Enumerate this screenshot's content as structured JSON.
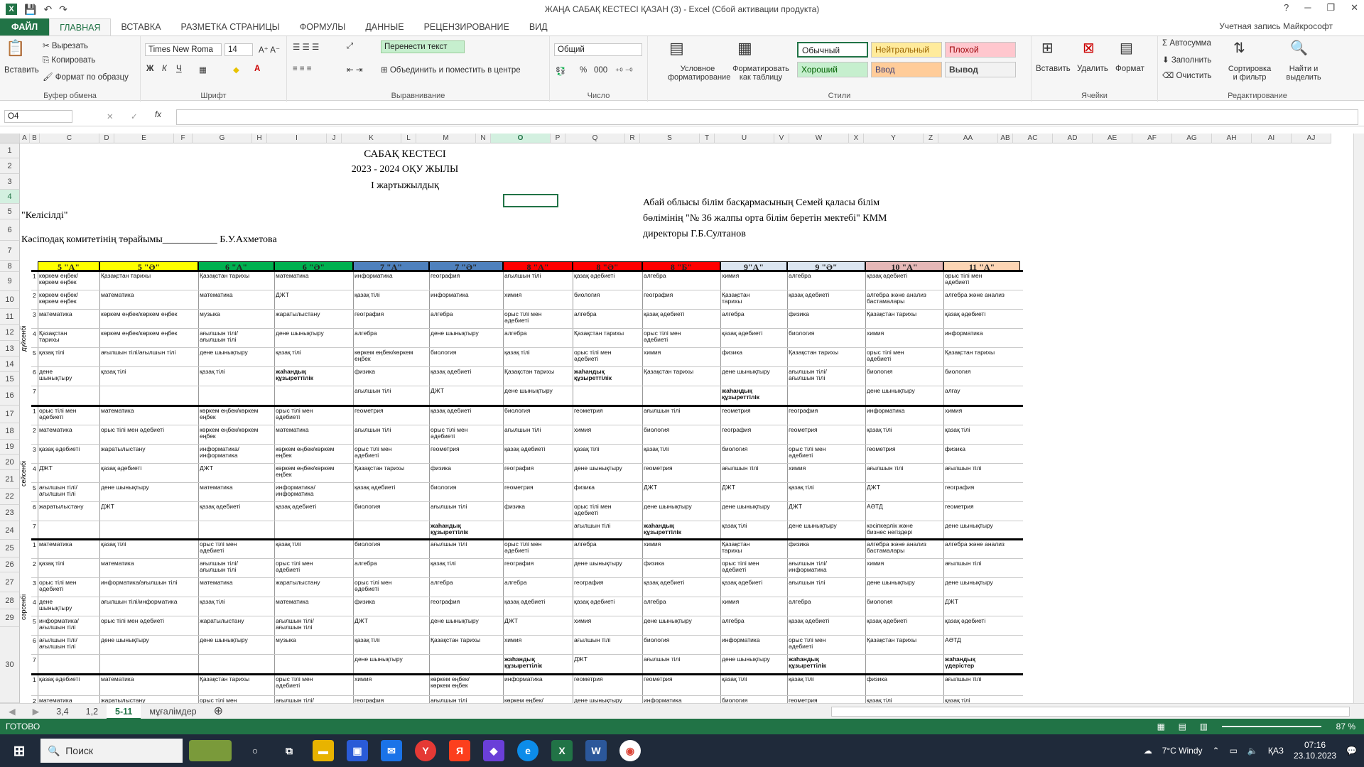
{
  "window": {
    "title": "ЖАҢА САБАҚ КЕСТЕСІ ҚАЗАН (3) - Excel (Сбой активации продукта)",
    "help": "?",
    "min": "─",
    "restore": "❐",
    "close": "✕"
  },
  "tabs": [
    "ФАЙЛ",
    "ГЛАВНАЯ",
    "ВСТАВКА",
    "РАЗМЕТКА СТРАНИЦЫ",
    "ФОРМУЛЫ",
    "ДАННЫЕ",
    "РЕЦЕНЗИРОВАНИЕ",
    "ВИД"
  ],
  "account": "Учетная запись Майкрософт",
  "ribbon": {
    "clipboard": {
      "label": "Буфер обмена",
      "paste": "Вставить",
      "cut": "Вырезать",
      "copy": "Копировать",
      "painter": "Формат по образцу"
    },
    "font": {
      "label": "Шрифт",
      "name": "Times New Roma",
      "size": "14"
    },
    "align": {
      "label": "Выравнивание",
      "wrap": "Перенести текст",
      "merge": "Объединить и поместить в центре"
    },
    "number": {
      "label": "Число",
      "format": "Общий",
      "percent": "%",
      "thousands": "000"
    },
    "styles": {
      "label": "Стили",
      "cond": "Условное форматирование",
      "table": "Форматировать как таблицу",
      "normal": "Обычный",
      "neutral": "Нейтральный",
      "bad": "Плохой",
      "good": "Хороший",
      "input": "Ввод",
      "output": "Вывод"
    },
    "cells": {
      "label": "Ячейки",
      "insert": "Вставить",
      "delete": "Удалить",
      "format": "Формат"
    },
    "edit": {
      "label": "Редактирование",
      "autosum": "Автосумма",
      "fill": "Заполнить",
      "clear": "Очистить",
      "sort": "Сортировка и фильтр",
      "find": "Найти и выделить"
    }
  },
  "namebox": "O4",
  "fx": "fx",
  "columns": [
    "A",
    "B",
    "C",
    "D",
    "E",
    "F",
    "G",
    "H",
    "I",
    "J",
    "K",
    "L",
    "M",
    "N",
    "O",
    "P",
    "Q",
    "R",
    "S",
    "T",
    "U",
    "V",
    "W",
    "X",
    "Y",
    "Z",
    "AA",
    "AB",
    "AC",
    "AD",
    "AE",
    "AF",
    "AG",
    "AH",
    "AI",
    "AJ"
  ],
  "rows": [
    "1",
    "2",
    "3",
    "4",
    "5",
    "6",
    "7",
    "8",
    "9",
    "10",
    "11",
    "12",
    "13",
    "14",
    "15",
    "16",
    "17",
    "18",
    "19",
    "20",
    "21",
    "22",
    "23",
    "24",
    "25",
    "26",
    "27",
    "28",
    "29",
    "30"
  ],
  "header": {
    "t1": "САБАҚ КЕСТЕСІ",
    "t2": "2023 - 2024 ОҚУ ЖЫЛЫ",
    "t3": "І жартыжылдық",
    "agreed": "\"Келісілді\"",
    "union": "Кәсіподақ комитетінің төрайымы___________ Б.У.Ахметова",
    "r1": "Абай облысы білім басқармасының Семей қаласы білім",
    "r2": "бөлімінің  \"№ 36 жалпы орта білім беретін мектебі\" КММ",
    "r3": "директоры                      Г.Б.Султанов"
  },
  "classes": [
    {
      "name": "5 \"А\"",
      "color": "#ffff00"
    },
    {
      "name": "5 \"Ә\"",
      "color": "#ffff00"
    },
    {
      "name": "6 \"А\"",
      "color": "#00b050"
    },
    {
      "name": "6 \"Ә\"",
      "color": "#00b050"
    },
    {
      "name": "7 \"А\"",
      "color": "#4f81bd"
    },
    {
      "name": "7 \"Ә\"",
      "color": "#4f81bd"
    },
    {
      "name": "8 \"А\"",
      "color": "#ff0000"
    },
    {
      "name": "8 \"Ә\"",
      "color": "#ff0000"
    },
    {
      "name": "8 \"Б\"",
      "color": "#ff0000"
    },
    {
      "name": "9\"А\"",
      "color": "#dce6f1"
    },
    {
      "name": "9 \"Ә\"",
      "color": "#dce6f1"
    },
    {
      "name": "10 \"А\"",
      "color": "#e6b8b7"
    },
    {
      "name": "11 \"А\"",
      "color": "#fcd5b4"
    }
  ],
  "days": [
    "дүйсенбі",
    "сейсенбі",
    "сәрсенбі"
  ],
  "monday": [
    [
      "көркем еңбек/көркем еңбек",
      "Қазақстан тарихы",
      "Қазақстан тарихы",
      "математика",
      "информатика",
      "география",
      "ағылшын тілі",
      "қазақ әдебиеті",
      "алгебра",
      "химия",
      "алгебра",
      "қазақ әдебиеті",
      "орыс тілі мен әдебиеті"
    ],
    [
      "көркем еңбек/көркем еңбек",
      "математика",
      "математика",
      "ДЖТ",
      "қазақ тілі",
      "информатика",
      "химия",
      "биология",
      "география",
      "Қазақстан тарихы",
      "қазақ әдебиеті",
      "алгебра және анализ бастамалары",
      "алгебра және анализ"
    ],
    [
      "математика",
      "көркем еңбек/көркем еңбек",
      "музыка",
      "жаратылыстану",
      "география",
      "алгебра",
      "орыс тілі мен әдебиеті",
      "алгебра",
      "қазақ әдебиеті",
      "алгебра",
      "физика",
      "Қазақстан тарихы",
      "қазақ әдебиеті"
    ],
    [
      "Қазақстан тарихы",
      "көркем еңбек/көркем еңбек",
      "ағылшын тілі/ағылшын тілі",
      "дене шынықтыру",
      "алгебра",
      "дене шынықтыру",
      "алгебра",
      "Қазақстан тарихы",
      "орыс тілі мен әдебиеті",
      "қазақ әдебиеті",
      "биология",
      "химия",
      "информатика"
    ],
    [
      "қазақ тілі",
      "ағылшын тілі/ағылшын тілі",
      "дене шынықтыру",
      "қазақ тілі",
      "көркем еңбек/көркем еңбек",
      "биология",
      "қазақ тілі",
      "орыс тілі мен әдебиеті",
      "химия",
      "физика",
      "Қазақстан тарихы",
      "орыс тілі мен әдебиеті",
      "Қазақстан тарихы"
    ],
    [
      "дене шынықтыру",
      "қазақ тілі",
      "қазақ тілі",
      "жаһандық құзыреттілік",
      "физика",
      "қазақ әдебиеті",
      "Қазақстан тарихы",
      "жаһандық құзыреттілік",
      "Қазақстан тарихы",
      "дене шынықтыру",
      "ағылшын тілі/ағылшын тілі",
      "биология",
      "биология"
    ],
    [
      "",
      "",
      "",
      "",
      "ағылшын тілі",
      "ДЖТ",
      "дене шынықтыру",
      "",
      "",
      "жаһандық құзыреттілік",
      "",
      "дене шынықтыру",
      "алгау"
    ]
  ],
  "tuesday": [
    [
      "орыс тілі мен әдебиеті",
      "математика",
      "көркем еңбек/көркем еңбек",
      "орыс тілі мен әдебиеті",
      "геометрия",
      "қазақ әдебиеті",
      "биология",
      "геометрия",
      "ағылшын тілі",
      "геометрия",
      "география",
      "информатика",
      "химия"
    ],
    [
      "математика",
      "орыс тілі мен әдебиеті",
      "көркем еңбек/көркем еңбек",
      "математика",
      "ағылшын тілі",
      "орыс тілі мен әдебиеті",
      "ағылшын тілі",
      "химия",
      "биология",
      "география",
      "геометрия",
      "қазақ тілі",
      "қазақ тілі"
    ],
    [
      "қазақ әдебиеті",
      "жаратылыстану",
      "информатика/информатика",
      "көркем еңбек/көркем еңбек",
      "орыс тілі мен әдебиеті",
      "геометрия",
      "қазақ әдебиеті",
      "қазақ тілі",
      "қазақ тілі",
      "биология",
      "орыс тілі мен әдебиеті",
      "геометрия",
      "физика"
    ],
    [
      "ДЖТ",
      "қазақ әдебиеті",
      "ДЖТ",
      "көркем еңбек/көркем еңбек",
      "Қазақстан тарихы",
      "физика",
      "география",
      "дене шынықтыру",
      "геометрия",
      "ағылшын тілі",
      "химия",
      "ағылшын тілі",
      "ағылшын тілі"
    ],
    [
      "ағылшын тілі/ағылшын тілі",
      "дене шынықтыру",
      "математика",
      "информатика/информатика",
      "қазақ әдебиеті",
      "биология",
      "геометрия",
      "физика",
      "ДЖТ",
      "ДЖТ",
      "қазақ тілі",
      "ДЖТ",
      "география"
    ],
    [
      "жаратылыстану",
      "ДЖТ",
      "қазақ әдебиеті",
      "қазақ әдебиеті",
      "биология",
      "ағылшын тілі",
      "физика",
      "орыс тілі мен әдебиеті",
      "дене шынықтыру",
      "дене шынықтыру",
      "ДЖТ",
      "АӘТД",
      "геометрия"
    ],
    [
      "",
      "",
      "",
      "",
      "",
      "жаһандық құзыреттілік",
      "",
      "ағылшын тілі",
      "жаһандық құзыреттілік",
      "қазақ тілі",
      "дене шынықтыру",
      "кәсіпкерлік және бизнес негіздері",
      "дене шынықтыру"
    ]
  ],
  "wednesday": [
    [
      "математика",
      "қазақ тілі",
      "орыс тілі мен әдебиеті",
      "қазақ тілі",
      "биология",
      "ағылшын тілі",
      "орыс тілі мен әдебиеті",
      "алгебра",
      "химия",
      "Қазақстан тарихы",
      "физика",
      "алгебра және анализ бастамалары",
      "алгебра және анализ"
    ],
    [
      "қазақ тілі",
      "математика",
      "ағылшын тілі/ағылшын тілі",
      "орыс тілі мен әдебиеті",
      "алгебра",
      "қазақ тілі",
      "география",
      "дене шынықтыру",
      "физика",
      "орыс тілі мен әдебиеті",
      "ағылшын тілі/информатика",
      "химия",
      "ағылшын тілі"
    ],
    [
      "орыс тілі мен әдебиеті",
      "информатика/ағылшын тілі",
      "математика",
      "жаратылыстану",
      "орыс тілі мен әдебиеті",
      "алгебра",
      "алгебра",
      "география",
      "қазақ әдебиеті",
      "қазақ әдебиеті",
      "ағылшын тілі",
      "дене шынықтыру",
      "дене шынықтыру"
    ],
    [
      "дене шынықтыру",
      "ағылшын тілі/информатика",
      "қазақ тілі",
      "математика",
      "физика",
      "география",
      "қазақ әдебиеті",
      "қазақ әдебиеті",
      "алгебра",
      "химия",
      "алгебра",
      "биология",
      "ДЖТ"
    ],
    [
      "информатика/ағылшын тілі",
      "орыс тілі мен әдебиеті",
      "жаратылыстану",
      "ағылшын тілі/ағылшын тілі",
      "ДЖТ",
      "дене шынықтыру",
      "ДЖТ",
      "химия",
      "дене шынықтыру",
      "алгебра",
      "қазақ әдебиеті",
      "қазақ әдебиеті",
      "қазақ әдебиеті"
    ],
    [
      "ағылшын тілі/ағылшын тілі",
      "дене шынықтыру",
      "дене шынықтыру",
      "музыка",
      "қазақ тілі",
      "Қазақстан тарихы",
      "химия",
      "ағылшын тілі",
      "биология",
      "информатика",
      "орыс тілі мен әдебиеті",
      "Қазақстан тарихы",
      "АӘТД"
    ],
    [
      "",
      "",
      "",
      "",
      "дене шынықтыру",
      "",
      "жаһандық құзыреттілік",
      "ДЖТ",
      "ағылшын тілі",
      "дене шынықтыру",
      "жаһандық құзыреттілік",
      "",
      "жаһандық үдерістер"
    ]
  ],
  "thursday": [
    [
      "қазақ әдебиеті",
      "математика",
      "Қазақстан тарихы",
      "орыс тілі мен әдебиеті",
      "химия",
      "көркем еңбек/көркем еңбек",
      "информатика",
      "геометрия",
      "геометрия",
      "қазақ тілі",
      "қазақ тілі",
      "физика",
      "ағылшын тілі"
    ],
    [
      "математика",
      "жаратылыстану",
      "орыс тілі мен әдебиеті",
      "ағылшын тілі/ағылшын тілі",
      "география",
      "ағылшын тілі",
      "көркем еңбек/көркем еңбек",
      "дене шынықтыру",
      "информатика",
      "биология",
      "геометрия",
      "қазақ тілі",
      "қазақ тілі"
    ]
  ],
  "sheets": [
    "3,4",
    "1,2",
    "5-11",
    "мұғалімдер"
  ],
  "status": "ГОТОВО",
  "zoom": "87 %",
  "taskbar": {
    "search": "Поиск",
    "weather": "7°C  Windy",
    "lang": "ҚАЗ",
    "time": "07:16",
    "date": "23.10.2023"
  }
}
